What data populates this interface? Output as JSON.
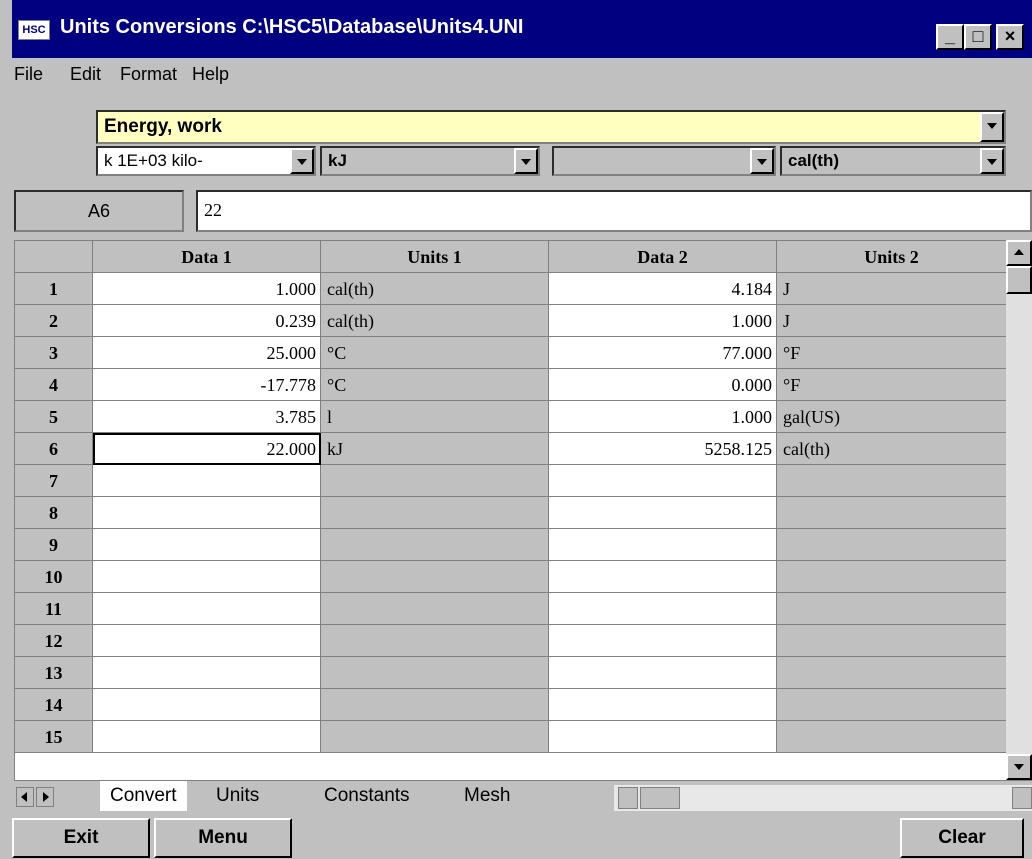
{
  "window": {
    "icon_text": "HSC",
    "title": "Units Conversions C:\\HSC5\\Database\\Units4.UNI",
    "minimize_symbol": "_",
    "maximize_symbol": "□",
    "close_symbol": "×"
  },
  "menu": [
    "File",
    "Edit",
    "Format",
    "Help"
  ],
  "selectors": {
    "category": "Energy, work",
    "prefix": "k  1E+03 kilo-",
    "unit1": "kJ",
    "prefix2": "",
    "unit2": "cal(th)"
  },
  "cell_ref": "A6",
  "formula_value": "22",
  "table": {
    "headers": [
      "Data 1",
      "Units 1",
      "Data 2",
      "Units 2"
    ],
    "rows": [
      {
        "n": "1",
        "d1": "1.000",
        "u1": "cal(th)",
        "d2": "4.184",
        "u2": "J"
      },
      {
        "n": "2",
        "d1": "0.239",
        "u1": "cal(th)",
        "d2": "1.000",
        "u2": "J"
      },
      {
        "n": "3",
        "d1": "25.000",
        "u1": "°C",
        "d2": "77.000",
        "u2": "°F"
      },
      {
        "n": "4",
        "d1": "-17.778",
        "u1": "°C",
        "d2": "0.000",
        "u2": "°F"
      },
      {
        "n": "5",
        "d1": "3.785",
        "u1": "l",
        "d2": "1.000",
        "u2": "gal(US)"
      },
      {
        "n": "6",
        "d1": "22.000",
        "u1": "kJ",
        "d2": "5258.125",
        "u2": "cal(th)"
      },
      {
        "n": "7",
        "d1": "",
        "u1": "",
        "d2": "",
        "u2": ""
      },
      {
        "n": "8",
        "d1": "",
        "u1": "",
        "d2": "",
        "u2": ""
      },
      {
        "n": "9",
        "d1": "",
        "u1": "",
        "d2": "",
        "u2": ""
      },
      {
        "n": "10",
        "d1": "",
        "u1": "",
        "d2": "",
        "u2": ""
      },
      {
        "n": "11",
        "d1": "",
        "u1": "",
        "d2": "",
        "u2": ""
      },
      {
        "n": "12",
        "d1": "",
        "u1": "",
        "d2": "",
        "u2": ""
      },
      {
        "n": "13",
        "d1": "",
        "u1": "",
        "d2": "",
        "u2": ""
      },
      {
        "n": "14",
        "d1": "",
        "u1": "",
        "d2": "",
        "u2": ""
      },
      {
        "n": "15",
        "d1": "",
        "u1": "",
        "d2": "",
        "u2": ""
      }
    ],
    "selected_row": 6
  },
  "tabs": [
    "Convert",
    "Units",
    "Constants",
    "Mesh"
  ],
  "buttons": {
    "exit": "Exit",
    "menu": "Menu",
    "clear": "Clear"
  },
  "colors": {
    "title_bar": "#000080",
    "category_bg": "#ffffc0",
    "face": "#c0c0c0"
  }
}
